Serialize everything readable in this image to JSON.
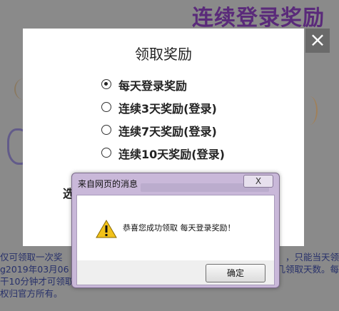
{
  "background": {
    "title": "连续登录奖励",
    "text_lines": [
      {
        "left": "仅可领取一次奖",
        "right": "，只能当天领"
      },
      {
        "left": "g2019年03月06",
        "right": "几领取天数。每"
      },
      {
        "left": "干10分钟才可领取",
        "right": ""
      },
      {
        "left": "权归官方所有。",
        "right": ""
      }
    ]
  },
  "modal": {
    "title": "领取奖励",
    "close_glyph": "×",
    "options": [
      {
        "label": "每天登录奖励",
        "selected": true
      },
      {
        "label": "连续3天奖励(登录)",
        "selected": false
      },
      {
        "label": "连续7天奖励(登录)",
        "selected": false
      },
      {
        "label": "连续10天奖励(登录)",
        "selected": false
      }
    ],
    "partial_label": "选"
  },
  "alert": {
    "title": "来自网页的消息",
    "close_glyph": "X",
    "message": "恭喜您成功领取 每天登录奖励！",
    "icon": "warning-icon",
    "ok_label": "确定"
  }
}
